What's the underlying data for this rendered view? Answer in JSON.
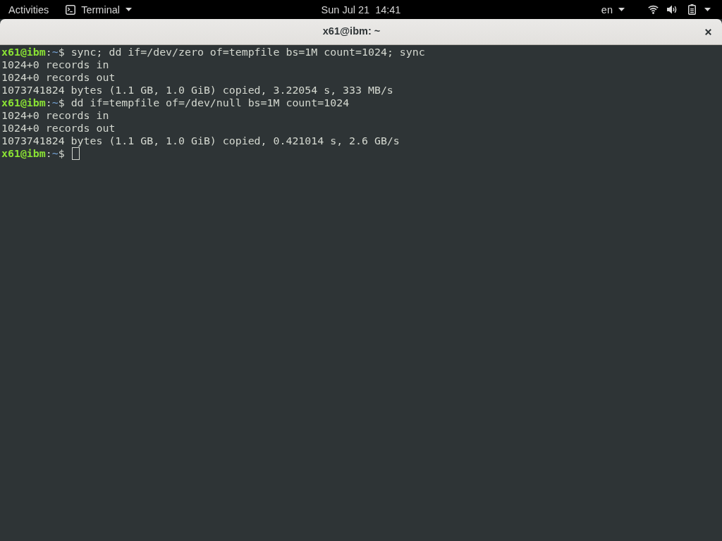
{
  "top_bar": {
    "activities": "Activities",
    "app_menu": "Terminal",
    "clock": "Sun Jul 21  14:41",
    "keyboard_layout": "en"
  },
  "window": {
    "title": "x61@ibm: ~",
    "terminal": {
      "lines": [
        {
          "kind": "prompt",
          "user_host": "x61@ibm",
          "separator": ":",
          "path": "~",
          "symbol": "$",
          "command": "sync; dd if=/dev/zero of=tempfile bs=1M count=1024; sync",
          "cursor": false
        },
        {
          "kind": "output",
          "text": "1024+0 records in"
        },
        {
          "kind": "output",
          "text": "1024+0 records out"
        },
        {
          "kind": "output",
          "text": "1073741824 bytes (1.1 GB, 1.0 GiB) copied, 3.22054 s, 333 MB/s"
        },
        {
          "kind": "prompt",
          "user_host": "x61@ibm",
          "separator": ":",
          "path": "~",
          "symbol": "$",
          "command": "dd if=tempfile of=/dev/null bs=1M count=1024",
          "cursor": false
        },
        {
          "kind": "output",
          "text": "1024+0 records in"
        },
        {
          "kind": "output",
          "text": "1024+0 records out"
        },
        {
          "kind": "output",
          "text": "1073741824 bytes (1.1 GB, 1.0 GiB) copied, 0.421014 s, 2.6 GB/s"
        },
        {
          "kind": "prompt",
          "user_host": "x61@ibm",
          "separator": ":",
          "path": "~",
          "symbol": "$",
          "cursor": true
        }
      ]
    }
  }
}
